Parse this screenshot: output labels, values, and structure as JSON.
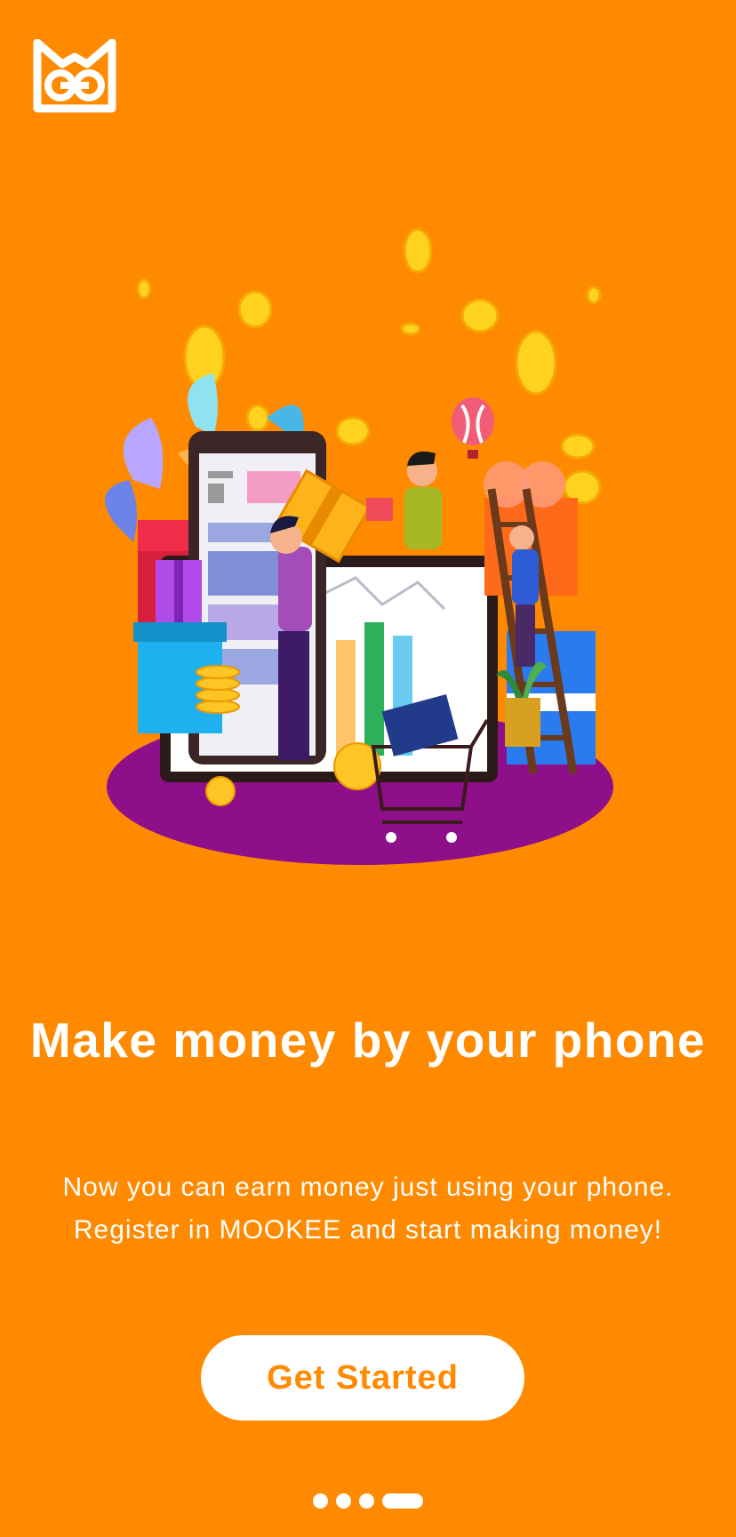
{
  "onboarding": {
    "headline": "Make money by your phone",
    "description_line1": "Now you can earn money just using your phone.",
    "description_line2": "Register in MOOKEE and start making money!",
    "cta_label": "Get Started",
    "page_count": 4,
    "active_page": 4
  },
  "colors": {
    "background": "#FF8A00",
    "button_bg": "#FFFFFF",
    "button_text": "#FF8A00"
  },
  "icons": [
    "mookee-logo-icon",
    "money-phone-illustration"
  ]
}
